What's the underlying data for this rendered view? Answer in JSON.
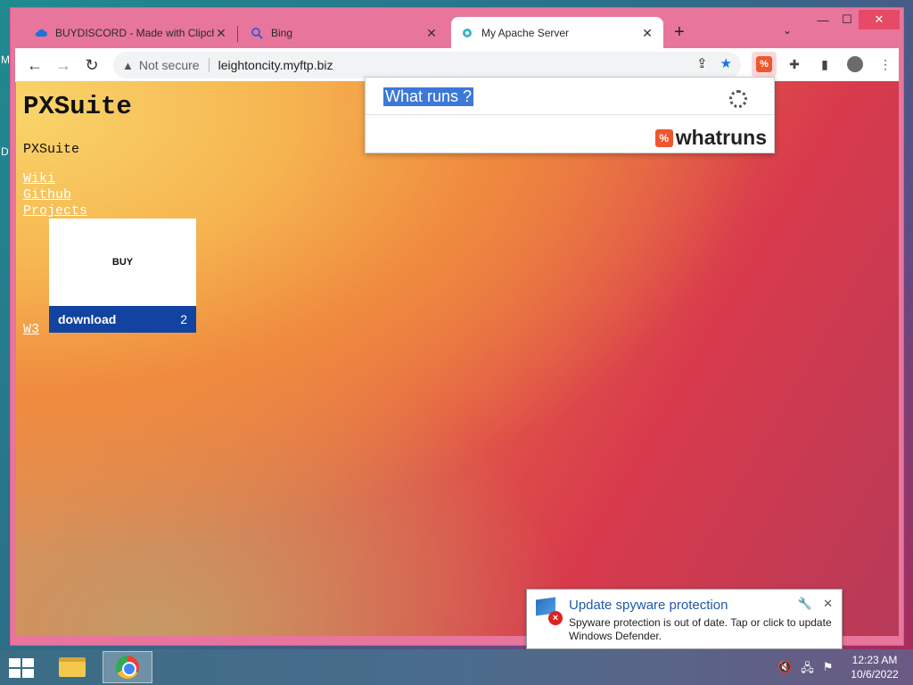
{
  "desktop": {
    "frag_m": "M",
    "frag_d": "D"
  },
  "browser": {
    "tabs": [
      {
        "title": "BUYDISCORD - Made with Clipch",
        "icon": "cloud-icon",
        "active": false
      },
      {
        "title": "Bing",
        "icon": "search-icon",
        "active": false
      },
      {
        "title": "My Apache Server",
        "icon": "globe-icon",
        "active": true
      }
    ],
    "new_tab": "+",
    "tab_list": "⌄",
    "window_controls": {
      "minimize": "—",
      "maximize": "☐",
      "close": "✕"
    },
    "toolbar": {
      "back": "←",
      "forward": "→",
      "reload": "↻"
    },
    "address": {
      "security": "Not secure",
      "url": "leightoncity.myftp.biz"
    }
  },
  "page": {
    "title": "PXSuite",
    "subtitle": "PXSuite",
    "links": [
      "Wiki",
      "Github",
      "Projects",
      "W3"
    ],
    "buy_card": {
      "label": "BUY",
      "download_label": "download",
      "download_count": "2"
    }
  },
  "whatruns_popup": {
    "title": "What runs ?",
    "logo_text": "whatruns",
    "logo_mark": "%"
  },
  "notification": {
    "title": "Update spyware protection",
    "body": "Spyware protection is out of date. Tap or click to update Windows Defender."
  },
  "taskbar": {
    "time": "12:23 AM",
    "date": "10/6/2022"
  },
  "colors": {
    "accent": "#1a73e8",
    "whatruns": "#f0562e",
    "buy_download_bg": "#1243a0",
    "tab_strip": "#e8759c"
  }
}
